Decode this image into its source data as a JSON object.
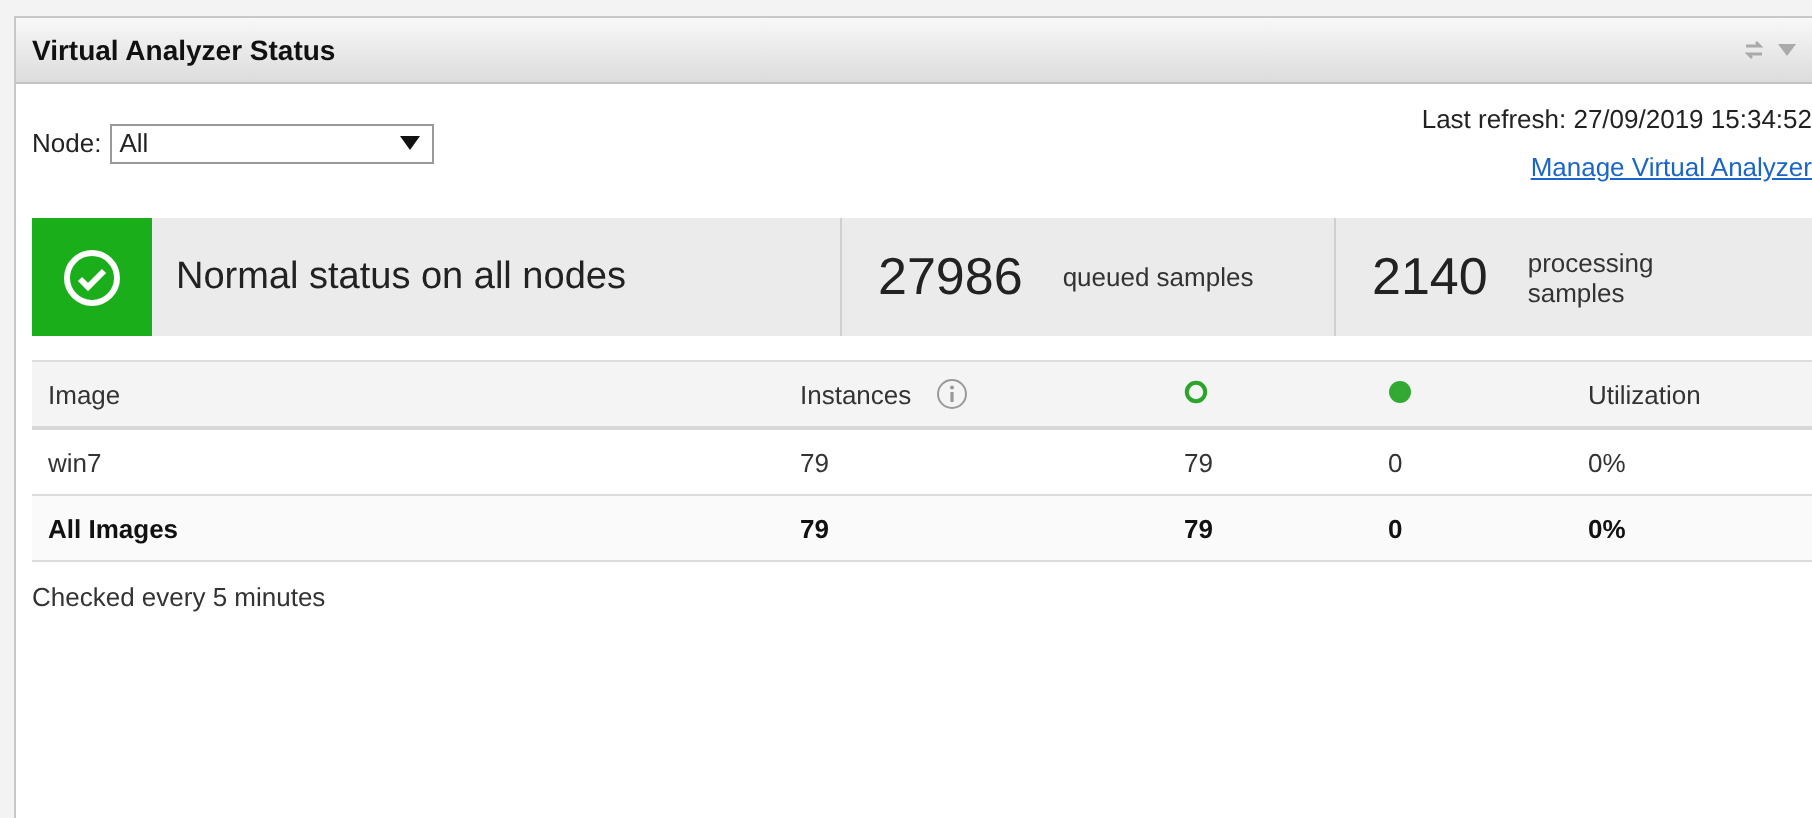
{
  "window": {
    "title": "Virtual Analyzer Status"
  },
  "node_filter": {
    "label": "Node:",
    "value": "All"
  },
  "last_refresh": "Last refresh: 27/09/2019 15:34:52",
  "manage_link": "Manage Virtual Analyzer",
  "status": {
    "kind": "ok",
    "message": "Normal status on all nodes"
  },
  "counters": [
    {
      "value": "27986",
      "label": "queued samples"
    },
    {
      "value": "2140",
      "label": "processing samples"
    }
  ],
  "table": {
    "columns": [
      {
        "kind": "text",
        "label": "Image"
      },
      {
        "kind": "info",
        "label": "Instances"
      },
      {
        "kind": "idle-icon"
      },
      {
        "kind": "busy-icon"
      },
      {
        "kind": "text",
        "label": "Utilization"
      }
    ],
    "rows": [
      {
        "kind": "normal",
        "cells": [
          "win7",
          "79",
          "79",
          "0",
          "0%"
        ]
      },
      {
        "kind": "total",
        "cells": [
          "All Images",
          "79",
          "79",
          "0",
          "0%"
        ]
      }
    ]
  },
  "footer": "Checked every 5 minutes"
}
